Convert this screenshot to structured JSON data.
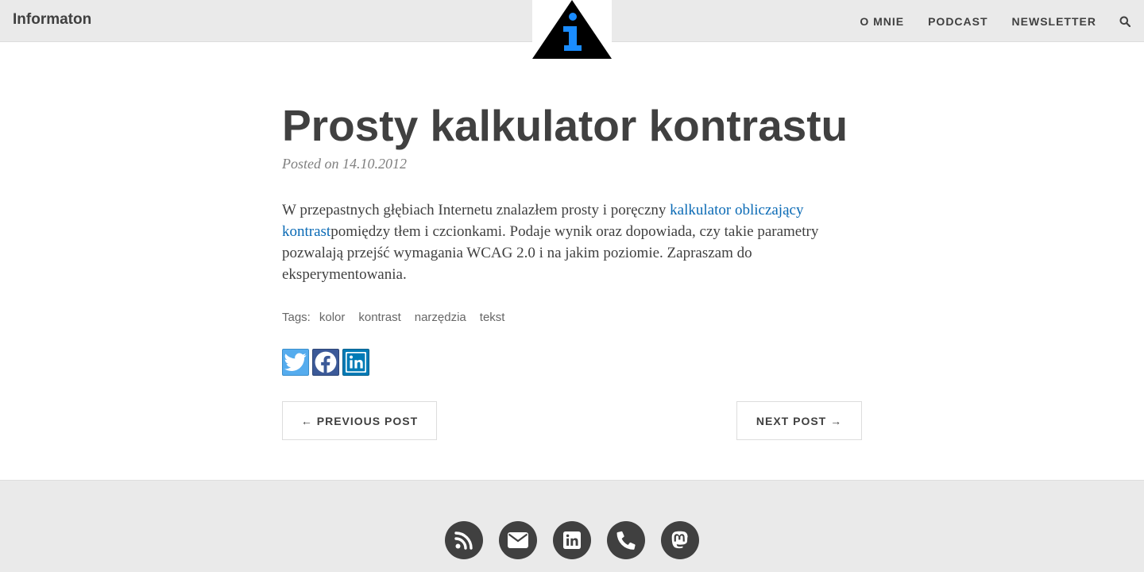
{
  "navbar": {
    "brand": "Informaton",
    "links": [
      "O MNIE",
      "PODCAST",
      "NEWSLETTER"
    ],
    "search_icon": "search-icon",
    "logo_colors": {
      "triangle": "#000000",
      "letter": "#1a8cff"
    }
  },
  "post": {
    "title": "Prosty kalkulator kontrastu",
    "meta": "Posted on 14.10.2012",
    "body_before": "W przepastnych głębiach Internetu znalazłem prosty i poręczny ",
    "body_link": "kalkulator obliczający kontrast",
    "body_after": "pomiędzy tłem i czcionkami. Podaje wynik oraz dopowiada, czy takie parametry pozwalają przejść wymagania WCAG 2.0 i na jakim poziomie. Zapraszam do eksperymentowania.",
    "tags_label": "Tags:",
    "tags": [
      "kolor",
      "kontrast",
      "narzędzia",
      "tekst"
    ]
  },
  "share": {
    "icons": [
      "twitter-icon",
      "facebook-icon",
      "linkedin-icon"
    ],
    "colors": {
      "twitter": "#55acee",
      "facebook": "#3b5998",
      "linkedin": "#007bb6"
    }
  },
  "pager": {
    "previous": "← PREVIOUS POST",
    "next": "NEXT POST →"
  },
  "footer": {
    "icons": [
      "rss-icon",
      "email-icon",
      "linkedin-icon",
      "phone-icon",
      "mastodon-icon"
    ]
  },
  "colors": {
    "navbar_bg": "#eaeaea",
    "text": "#404040",
    "link": "#0a6ab5",
    "footer_bg": "#eaeaea"
  }
}
